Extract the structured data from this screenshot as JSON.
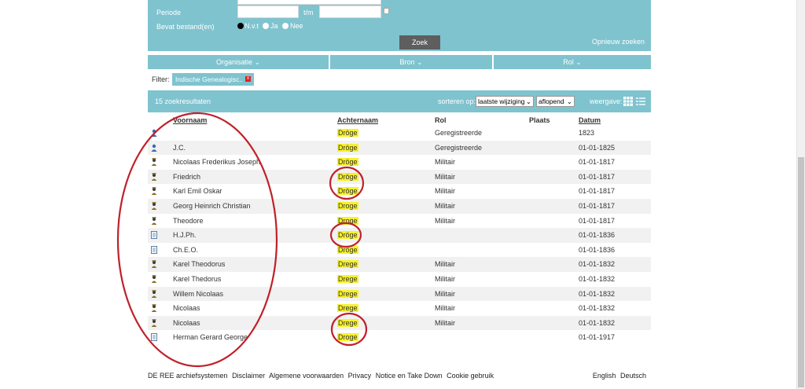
{
  "search": {
    "periode_label": "Periode",
    "tm_label": "t/m",
    "bestand_label": "Bevat bestand(en)",
    "radios": [
      {
        "label": "N.v.t",
        "selected": true
      },
      {
        "label": "Ja",
        "selected": false
      },
      {
        "label": "Nee",
        "selected": false
      }
    ],
    "search_button": "Zoek",
    "reset_link": "Opnieuw zoeken"
  },
  "facets": [
    "Organisatie",
    "Bron",
    "Rol"
  ],
  "filter": {
    "label": "Filter:",
    "chip": "Indische Genealogisc..",
    "chip_close": "x"
  },
  "results": {
    "count_label": "15 zoekresultaten",
    "sort_label": "sorteren op:",
    "sort_value": "laatste wijziging",
    "order_value": "aflopend",
    "view_label": "weergave:"
  },
  "table": {
    "headers": {
      "voornaam": "Voornaam",
      "achternaam": "Achternaam",
      "rol": "Rol",
      "plaats": "Plaats",
      "datum": "Datum"
    },
    "rows": [
      {
        "icon": "person-blue-icon",
        "voornaam": "",
        "achternaam": "Dröge",
        "rol": "Geregistreerde",
        "plaats": "",
        "datum": "1823"
      },
      {
        "icon": "person-blue-icon",
        "voornaam": "J.C.",
        "achternaam": "Dröge",
        "rol": "Geregistreerde",
        "plaats": "",
        "datum": "01-01-1825"
      },
      {
        "icon": "soldier-icon",
        "voornaam": "Nicolaas Frederikus Joseph",
        "achternaam": "Dröge",
        "rol": "Militair",
        "plaats": "",
        "datum": "01-01-1817"
      },
      {
        "icon": "soldier-icon",
        "voornaam": "Friedrich",
        "achternaam": "Dröge",
        "rol": "Militair",
        "plaats": "",
        "datum": "01-01-1817"
      },
      {
        "icon": "soldier-icon",
        "voornaam": "Karl Emil Oskar",
        "achternaam": "Dröge",
        "rol": "Militair",
        "plaats": "",
        "datum": "01-01-1817"
      },
      {
        "icon": "soldier-icon",
        "voornaam": "Georg Heinrich Christian",
        "achternaam": "Droge",
        "rol": "Militair",
        "plaats": "",
        "datum": "01-01-1817"
      },
      {
        "icon": "soldier-icon",
        "voornaam": "Theodore",
        "achternaam": "Droge",
        "rol": "Militair",
        "plaats": "",
        "datum": "01-01-1817"
      },
      {
        "icon": "document-icon",
        "voornaam": "H.J.Ph.",
        "achternaam": "Dröge",
        "rol": "",
        "plaats": "",
        "datum": "01-01-1836"
      },
      {
        "icon": "document-icon",
        "voornaam": "Ch.E.O.",
        "achternaam": "Dröge",
        "rol": "",
        "plaats": "",
        "datum": "01-01-1836"
      },
      {
        "icon": "soldier-icon",
        "voornaam": "Karel Theodorus",
        "achternaam": "Drege",
        "rol": "Militair",
        "plaats": "",
        "datum": "01-01-1832"
      },
      {
        "icon": "soldier-icon",
        "voornaam": "Karel Thedorus",
        "achternaam": "Drege",
        "rol": "Militair",
        "plaats": "",
        "datum": "01-01-1832"
      },
      {
        "icon": "soldier-icon",
        "voornaam": "Willem Nicolaas",
        "achternaam": "Drege",
        "rol": "Militair",
        "plaats": "",
        "datum": "01-01-1832"
      },
      {
        "icon": "soldier-icon",
        "voornaam": "Nicolaas",
        "achternaam": "Drege",
        "rol": "Militair",
        "plaats": "",
        "datum": "01-01-1832"
      },
      {
        "icon": "soldier-icon",
        "voornaam": "Nicolaas",
        "achternaam": "Drege",
        "rol": "Militair",
        "plaats": "",
        "datum": "01-01-1832"
      },
      {
        "icon": "document-icon",
        "voornaam": "Herman Gerard George",
        "achternaam": "Droge",
        "rol": "",
        "plaats": "",
        "datum": "01-01-1917"
      }
    ]
  },
  "footer": {
    "links": [
      "DE REE archiefsystemen",
      "Disclaimer",
      "Algemene voorwaarden",
      "Privacy",
      "Notice en Take Down",
      "Cookie gebruik"
    ],
    "lang": [
      "English",
      "Deutsch"
    ]
  },
  "colors": {
    "panel": "#7fc3cf",
    "highlight": "#f7f12b",
    "annotation": "#c0202a",
    "button": "#5e5e5e"
  }
}
